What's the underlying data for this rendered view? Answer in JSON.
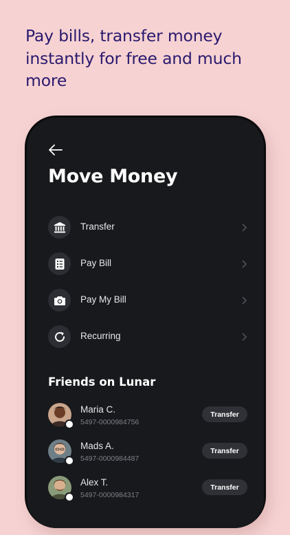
{
  "headline": "Pay bills, transfer money instantly for free and much more",
  "screen": {
    "title": "Move Money",
    "menu": [
      {
        "label": "Transfer",
        "icon": "bank-icon"
      },
      {
        "label": "Pay Bill",
        "icon": "bill-icon"
      },
      {
        "label": "Pay My Bill",
        "icon": "camera-icon"
      },
      {
        "label": "Recurring",
        "icon": "refresh-icon"
      }
    ],
    "friends_title": "Friends on Lunar",
    "friends": [
      {
        "name": "Maria C.",
        "account": "5497-0000984756",
        "button": "Transfer"
      },
      {
        "name": "Mads A.",
        "account": "5497-0000984487",
        "button": "Transfer"
      },
      {
        "name": "Alex T.",
        "account": "5497-0000984317",
        "button": "Transfer"
      }
    ]
  },
  "colors": {
    "background": "#f6d2d2",
    "headline": "#2a1a6e",
    "screen": "#18191c",
    "button": "#2f3136"
  }
}
